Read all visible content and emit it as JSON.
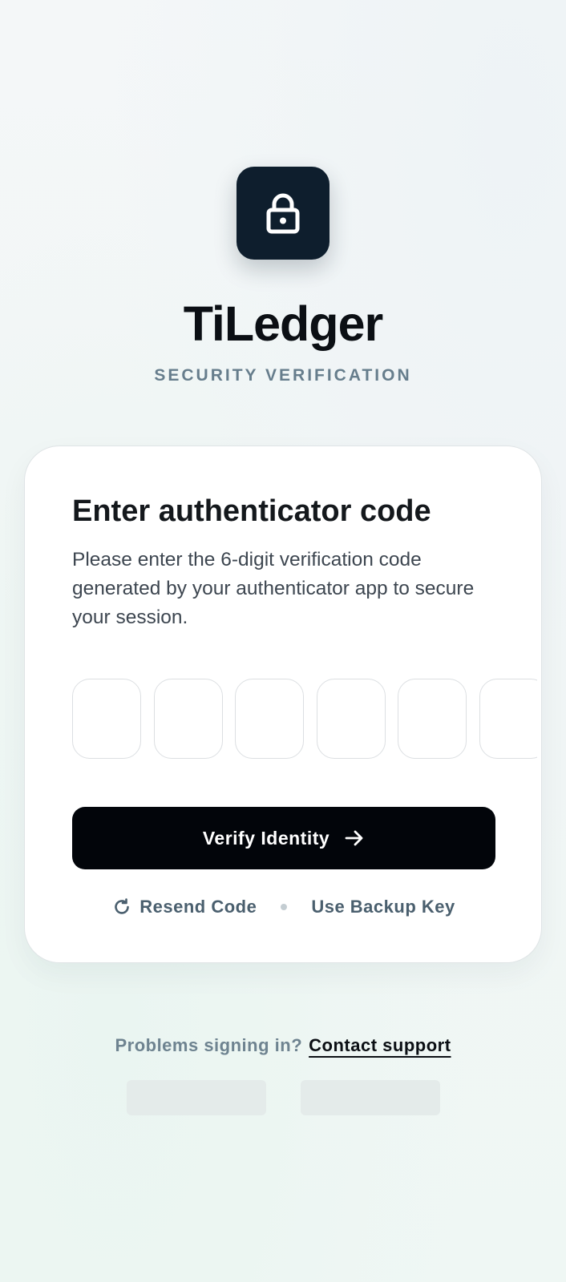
{
  "brand": {
    "name": "TiLedger",
    "subtitle": "SECURITY VERIFICATION",
    "logo_icon": "lock-icon",
    "logo_bg_color": "#0e1e2d"
  },
  "card": {
    "heading": "Enter authenticator code",
    "description": "Please enter the 6-digit verification code generated by your authenticator app to secure your session.",
    "code_digits": [
      "",
      "",
      "",
      "",
      "",
      ""
    ],
    "verify_button": {
      "label": "Verify Identity",
      "icon": "arrow-right-icon",
      "bg_color": "#02050a"
    },
    "resend_link": {
      "label": "Resend Code",
      "icon": "refresh-icon"
    },
    "backup_link": {
      "label": "Use Backup Key"
    }
  },
  "footer": {
    "help_text": "Problems signing in?",
    "support_link": "Contact support"
  }
}
